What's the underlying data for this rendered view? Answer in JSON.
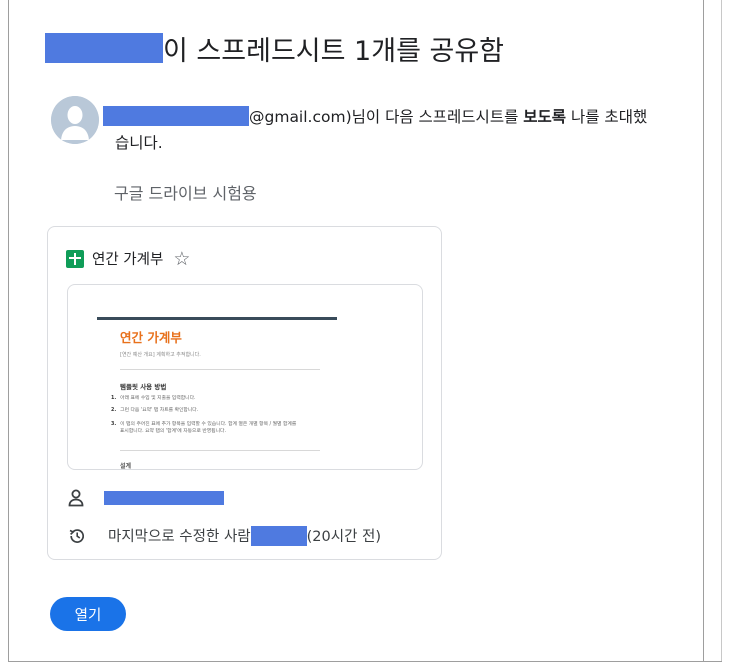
{
  "email": {
    "title_suffix": "이 스프레드시트 1개를 공유함",
    "invite": {
      "email_suffix": "@gmail.com)님이 다음 스프레드시트를 ",
      "emphasis": "보도록",
      "after": " 나를 초대했",
      "line2": "습니다."
    },
    "note": "구글 드라이브 시험용",
    "file": {
      "name": "연간 가계부",
      "icon": "google-sheets-icon",
      "preview": {
        "title": "연간 가계부",
        "subtitle": "[연간 예산 개요] 계획하고 추적합니다.",
        "section_heading": "템플릿 사용 방법",
        "items": [
          {
            "num": "1.",
            "text": "아래 표에 수입 및 지출을 입력합니다."
          },
          {
            "num": "2.",
            "text": "그런 다음 '요약' 탭 차트를 확인합니다."
          },
          {
            "num": "3.",
            "text": "이 탭의 주어진 표에 추가 항목을 입력할 수 있습니다. 합계 열은 개별 항목 / 월별 합계를"
          },
          {
            "num": "",
            "text": "표시합니다. 요약 탭의 '합계'에 자동으로 반영됩니다."
          }
        ],
        "bottom_heading": "설계"
      },
      "owner_icon": "person-icon",
      "history_icon": "history-icon",
      "last_modified_prefix": "마지막으로 수정한 사람",
      "last_modified_suffix": "(20시간 전)"
    },
    "open_button": "열기",
    "colors": {
      "accent": "#1a73e8",
      "sheets_green": "#0f9d58",
      "redaction": "#4f7ae0"
    }
  }
}
